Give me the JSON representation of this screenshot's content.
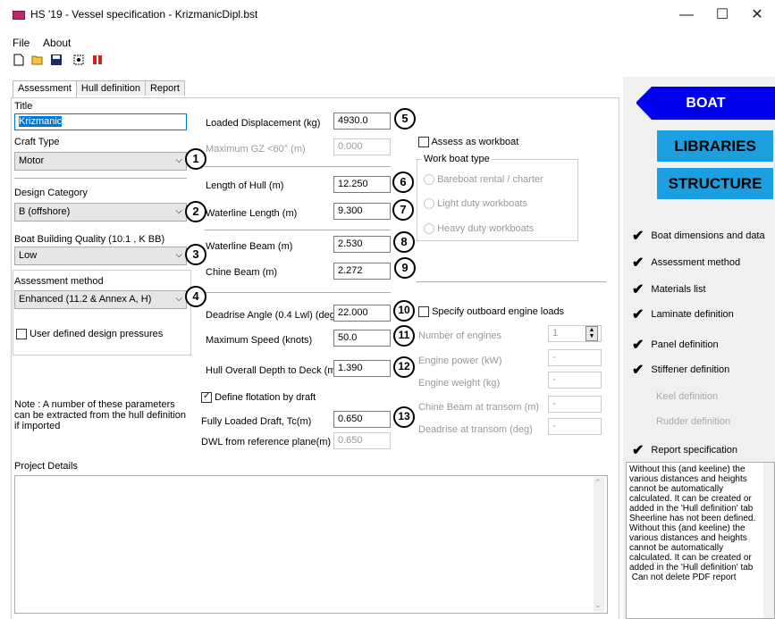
{
  "window": {
    "title": "HS '19 - Vessel specification - KrizmanicDipl.bst",
    "minimize": "—",
    "maximize": "☐",
    "close": "✕"
  },
  "menu": {
    "file": "File",
    "about": "About"
  },
  "toolbar": {
    "icons": [
      "new-file-icon",
      "open-folder-icon",
      "save-icon",
      "fit-view-icon",
      "exit-icon"
    ]
  },
  "tabs": [
    "Assessment",
    "Hull definition",
    "Report"
  ],
  "left": {
    "title_label": "Title",
    "title_value": "Krizmanic",
    "craft_type_label": "Craft Type",
    "craft_type_value": "Motor",
    "design_category_label": "Design Category",
    "design_category_value": "B (offshore)",
    "building_quality_label": "Boat Building Quality (10.1 , K BB)",
    "building_quality_value": "Low",
    "assessment_method_label": "Assessment method",
    "assessment_method_value": "Enhanced (11.2 & Annex A, H)",
    "user_pressures_label": "User defined design pressures",
    "note": "Note : A number of these parameters can be extracted from the hull definition if imported"
  },
  "middle": {
    "loaded_displacement_label": "Loaded Displacement (kg)",
    "loaded_displacement_value": "4930.0",
    "max_gz_label": "Maximum GZ <60° (m)",
    "max_gz_value": "0.000",
    "length_hull_label": "Length of Hull (m)",
    "length_hull_value": "12.250",
    "waterline_length_label": "Waterline Length (m)",
    "waterline_length_value": "9.300",
    "waterline_beam_label": "Waterline Beam (m)",
    "waterline_beam_value": "2.530",
    "chine_beam_label": "Chine Beam (m)",
    "chine_beam_value": "2.272",
    "deadrise_label": "Deadrise Angle (0.4 Lwl)  (deg)",
    "deadrise_value": "22.000",
    "max_speed_label": "Maximum Speed (knots)",
    "max_speed_value": "50.0",
    "depth_label": "Hull Overall Depth to Deck (m)",
    "depth_value": "1.390",
    "flotation_label": "Define flotation by draft",
    "draft_label": "Fully Loaded Draft, Tc(m)",
    "draft_value": "0.650",
    "dwl_label": "DWL from reference plane(m)",
    "dwl_value": "0.650"
  },
  "workboat": {
    "assess_label": "Assess as workboat",
    "group_label": "Work boat type",
    "options": [
      "Bareboat rental / charter",
      "Light duty workboats",
      "Heavy duty workboats"
    ]
  },
  "engine": {
    "specify_label": "Specify outboard engine loads",
    "num_engines_label": "Number of engines",
    "num_engines_value": "1",
    "engine_power_label": "Engine power (kW)",
    "engine_power_value": "-",
    "engine_weight_label": "Engine weight (kg)",
    "engine_weight_value": "-",
    "chine_transom_label": "Chine Beam at transom (m)",
    "chine_transom_value": "-",
    "deadrise_transom_label": "Deadrise at transom (deg)",
    "deadrise_transom_value": "-"
  },
  "project_details_label": "Project Details",
  "markers": [
    "1",
    "2",
    "3",
    "4",
    "5",
    "6",
    "7",
    "8",
    "9",
    "10",
    "11",
    "12",
    "13"
  ],
  "sidebar": {
    "boat": "BOAT",
    "libraries": "LIBRARIES",
    "structure": "STRUCTURE",
    "items": [
      {
        "label": "Boat dimensions and data",
        "done": true
      },
      {
        "label": "Assessment method",
        "done": true
      },
      {
        "label": "Materials list",
        "done": true
      },
      {
        "label": "Laminate definition",
        "done": true
      },
      {
        "label": "Panel definition",
        "done": true
      },
      {
        "label": "Stiffener definition",
        "done": true
      },
      {
        "label": "Keel definition",
        "done": false
      },
      {
        "label": "Rudder definition",
        "done": false
      },
      {
        "label": "Report specification",
        "done": true
      }
    ],
    "info_lines": [
      "Without this (and keeline) the",
      "various distances and heights",
      "cannot be automatically",
      "calculated. It can be created or",
      "added in the 'Hull definition' tab",
      "Sheerline has not been defined.",
      "Without this (and keeline) the",
      "various distances and heights",
      "cannot be automatically",
      "calculated. It can be created or",
      "added in the 'Hull definition' tab",
      " Can not delete PDF report"
    ]
  },
  "colors": {
    "accent": "#0078d7",
    "boat_banner": "#0000ee",
    "banner": "#1a9fe0",
    "app_icon": "#c0286c"
  }
}
